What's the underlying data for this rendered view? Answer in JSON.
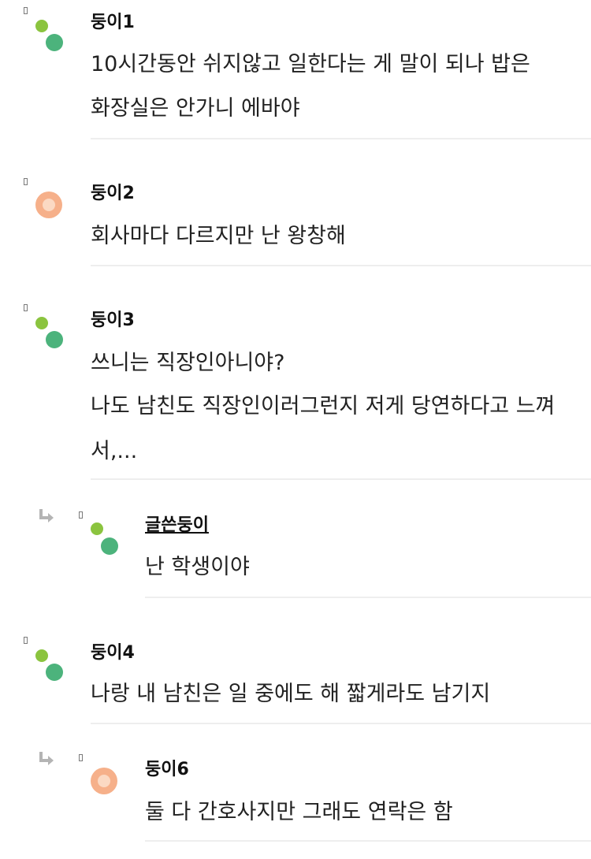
{
  "comments": [
    {
      "author": "둥이1",
      "lines": [
        "10시간동안 쉬지않고 일한다는 게 말이 되나 밥은",
        "화장실은 안가니 에바야"
      ]
    },
    {
      "author": "둥이2",
      "lines": [
        "회사마다 다르지만 난 왕창해"
      ]
    },
    {
      "author": "둥이3",
      "lines": [
        "쓰니는 직장인아니야?",
        "나도 남친도 직장인이러그런지 저게 당연하다고 느껴",
        "서,..."
      ]
    },
    {
      "author": "글쓴둥이",
      "lines": [
        "난 학생이야"
      ]
    },
    {
      "author": "둥이4",
      "lines": [
        "나랑 내 남친은 일 중에도 해 짧게라도 남기지"
      ]
    },
    {
      "author": "둥이6",
      "lines": [
        "둘 다 간호사지만 그래도 연락은 함"
      ]
    }
  ],
  "colors": {
    "avatar_small_green": "#8bc43f",
    "avatar_large_green": "#4cb37c",
    "avatar_peach": "#f6b08a"
  }
}
